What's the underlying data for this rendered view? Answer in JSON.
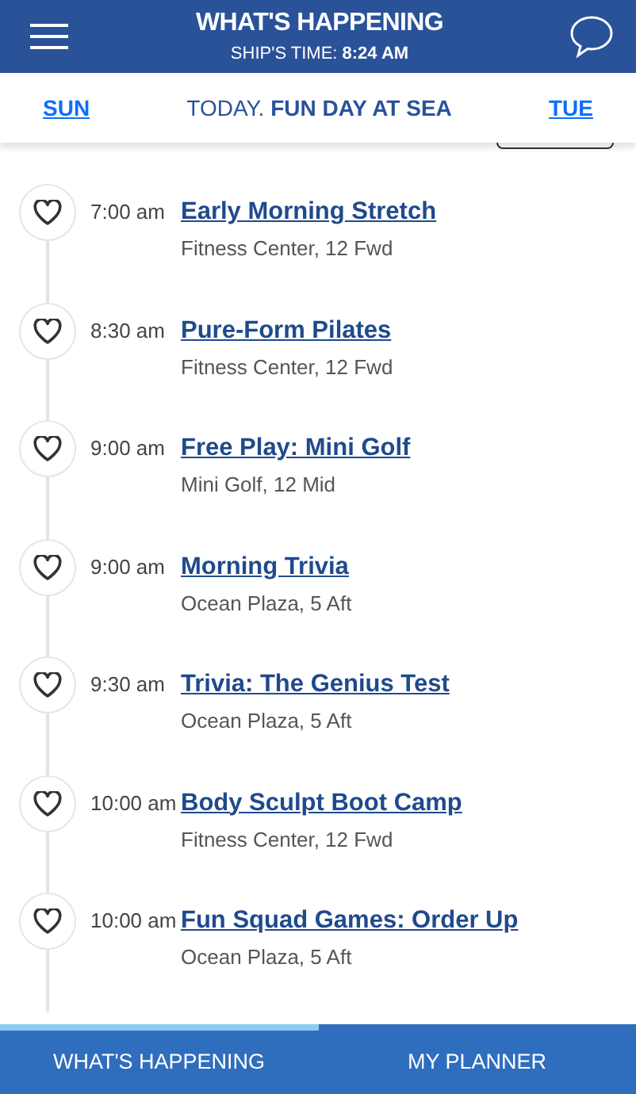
{
  "header": {
    "title": "WHAT'S HAPPENING",
    "ships_time": "SHIP'S TIME: **8:24 AM**"
  },
  "day_nav": {
    "previous": "SUN",
    "current": "TODAY. **FUN DAY AT SEA**",
    "next": "TUE"
  },
  "events": [
    {
      "time": "7:00 am",
      "title": "Early Morning Stretch",
      "location": "Fitness Center, 12 Fwd",
      "favorite": false
    },
    {
      "time": "8:30 am",
      "title": "Pure-Form Pilates",
      "location": "Fitness Center, 12 Fwd",
      "favorite": false
    },
    {
      "time": "9:00 am",
      "title": "Free Play: Mini Golf",
      "location": "Mini Golf, 12 Mid",
      "favorite": false
    },
    {
      "time": "9:00 am",
      "title": "Morning Trivia",
      "location": "Ocean Plaza, 5 Aft",
      "favorite": false
    },
    {
      "time": "9:30 am",
      "title": "Trivia: The Genius Test",
      "location": "Ocean Plaza, 5 Aft",
      "favorite": false
    },
    {
      "time": "10:00 am",
      "title": "Body Sculpt Boot Camp",
      "location": "Fitness Center, 12 Fwd",
      "favorite": false
    },
    {
      "time": "10:00 am",
      "title": "Fun Squad Games: Order Up",
      "location": "Ocean Plaza, 5 Aft",
      "favorite": false
    }
  ],
  "bottom_tabs": [
    {
      "label": "WHAT'S HAPPENING",
      "selected": true
    },
    {
      "label": "MY PLANNER",
      "selected": false
    }
  ]
}
